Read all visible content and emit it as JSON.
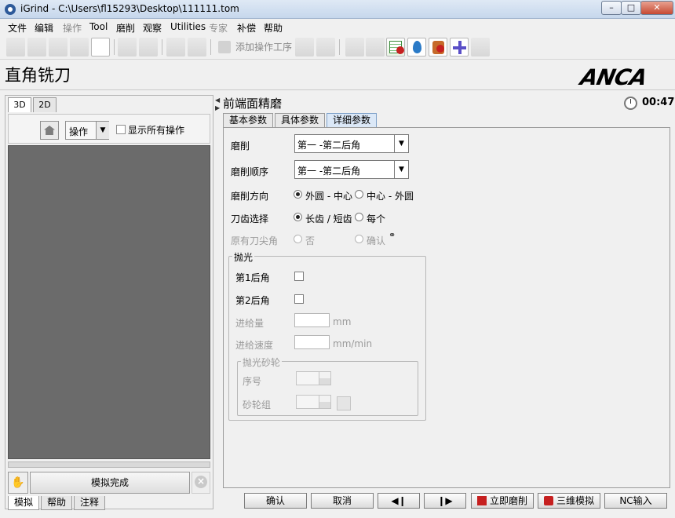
{
  "window": {
    "title": "iGrind - C:\\Users\\fl15293\\Desktop\\111111.tom",
    "min_glyph": "–",
    "max_glyph": "□",
    "close_glyph": "✕"
  },
  "menu": [
    {
      "label": "文件",
      "enabled": true
    },
    {
      "label": "编辑",
      "enabled": true
    },
    {
      "label": "操作",
      "enabled": false
    },
    {
      "label": "Tool",
      "enabled": true
    },
    {
      "label": "磨削",
      "enabled": true
    },
    {
      "label": "观察",
      "enabled": true
    },
    {
      "label": "Utilities",
      "enabled": true
    },
    {
      "label": "专家",
      "enabled": false
    },
    {
      "label": "补偿",
      "enabled": true
    },
    {
      "label": "帮助",
      "enabled": true
    }
  ],
  "toolbar": {
    "add_operation_label": "添加操作工序"
  },
  "header": {
    "page_title": "直角铣刀",
    "logo_text": "ANCA"
  },
  "left_panel": {
    "view_tabs": [
      "3D",
      "2D"
    ],
    "operation_combo": "操作",
    "show_all_label": "显示所有操作",
    "show_all_checked": false,
    "sim_status": "模拟完成",
    "hand_glyph": "✋",
    "bottom_tabs": [
      "模拟",
      "帮助",
      "注释"
    ]
  },
  "right_panel": {
    "operation_title": "前端面精磨",
    "timer": "00:47",
    "tabs": [
      "基本参数",
      "具体参数",
      "详细参数"
    ],
    "active_tab": "详细参数",
    "form": {
      "grind_label": "磨削",
      "grind_value": "第一 -第二后角",
      "grind_order_label": "磨削顺序",
      "grind_order_value": "第一 -第二后角",
      "direction_label": "磨削方向",
      "direction_options": [
        "外圆 - 中心",
        "中心 - 外圆"
      ],
      "direction_selected": "外圆 - 中心",
      "tooth_label": "刀齿选择",
      "tooth_options": [
        "长齿 / 短齿",
        "每个"
      ],
      "tooth_selected": "长齿 / 短齿",
      "orig_tip_label": "原有刀尖角",
      "orig_tip_options": [
        "否",
        "确认"
      ],
      "link_glyph": "⚭",
      "polish": {
        "title": "抛光",
        "first_relief_label": "第1后角",
        "second_relief_label": "第2后角",
        "feed_label": "进给量",
        "feed_unit": "mm",
        "feed_rate_label": "进给速度",
        "feed_rate_unit": "mm/min",
        "wheel_group": {
          "title": "抛光砂轮",
          "index_label": "序号",
          "wheel_set_label": "砂轮组"
        }
      }
    }
  },
  "bottom_buttons": [
    {
      "label": "确认",
      "icon": "none"
    },
    {
      "label": "取消",
      "icon": "none"
    },
    {
      "label": "◀❙",
      "icon": "prev"
    },
    {
      "label": "❙▶",
      "icon": "next"
    },
    {
      "label": "立即磨削",
      "icon": "grind-now-icon"
    },
    {
      "label": "三维模拟",
      "icon": "simulate-3d-icon"
    },
    {
      "label": "NC输入",
      "icon": "none"
    }
  ],
  "colors": {
    "sim_view": "#6b6b6b",
    "active_tab": "#dbe8f7",
    "grind_now_icon": "#c62020",
    "simulate_icon": "#c62020"
  }
}
